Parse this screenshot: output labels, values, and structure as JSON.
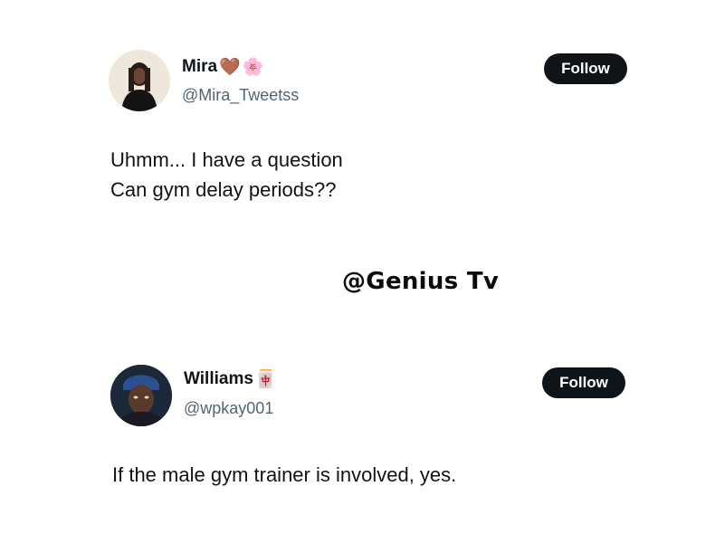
{
  "tweet1": {
    "display_name": "Mira",
    "name_emojis": [
      "🤎",
      "🌸"
    ],
    "handle": "@Mira_Tweetss",
    "follow_label": "Follow",
    "text_lines": [
      "Uhmm... I have a question",
      "Can gym delay periods??"
    ]
  },
  "watermark": "@Genius Tv",
  "tweet2": {
    "display_name": "Williams",
    "name_emojis": [
      "🀄"
    ],
    "handle": "@wpkay001",
    "follow_label": "Follow",
    "text_lines": [
      "If the male gym trainer is involved, yes."
    ]
  },
  "colors": {
    "text_primary": "#0f1419",
    "text_secondary": "#536471",
    "button_bg": "#0f1419",
    "button_text": "#ffffff"
  }
}
